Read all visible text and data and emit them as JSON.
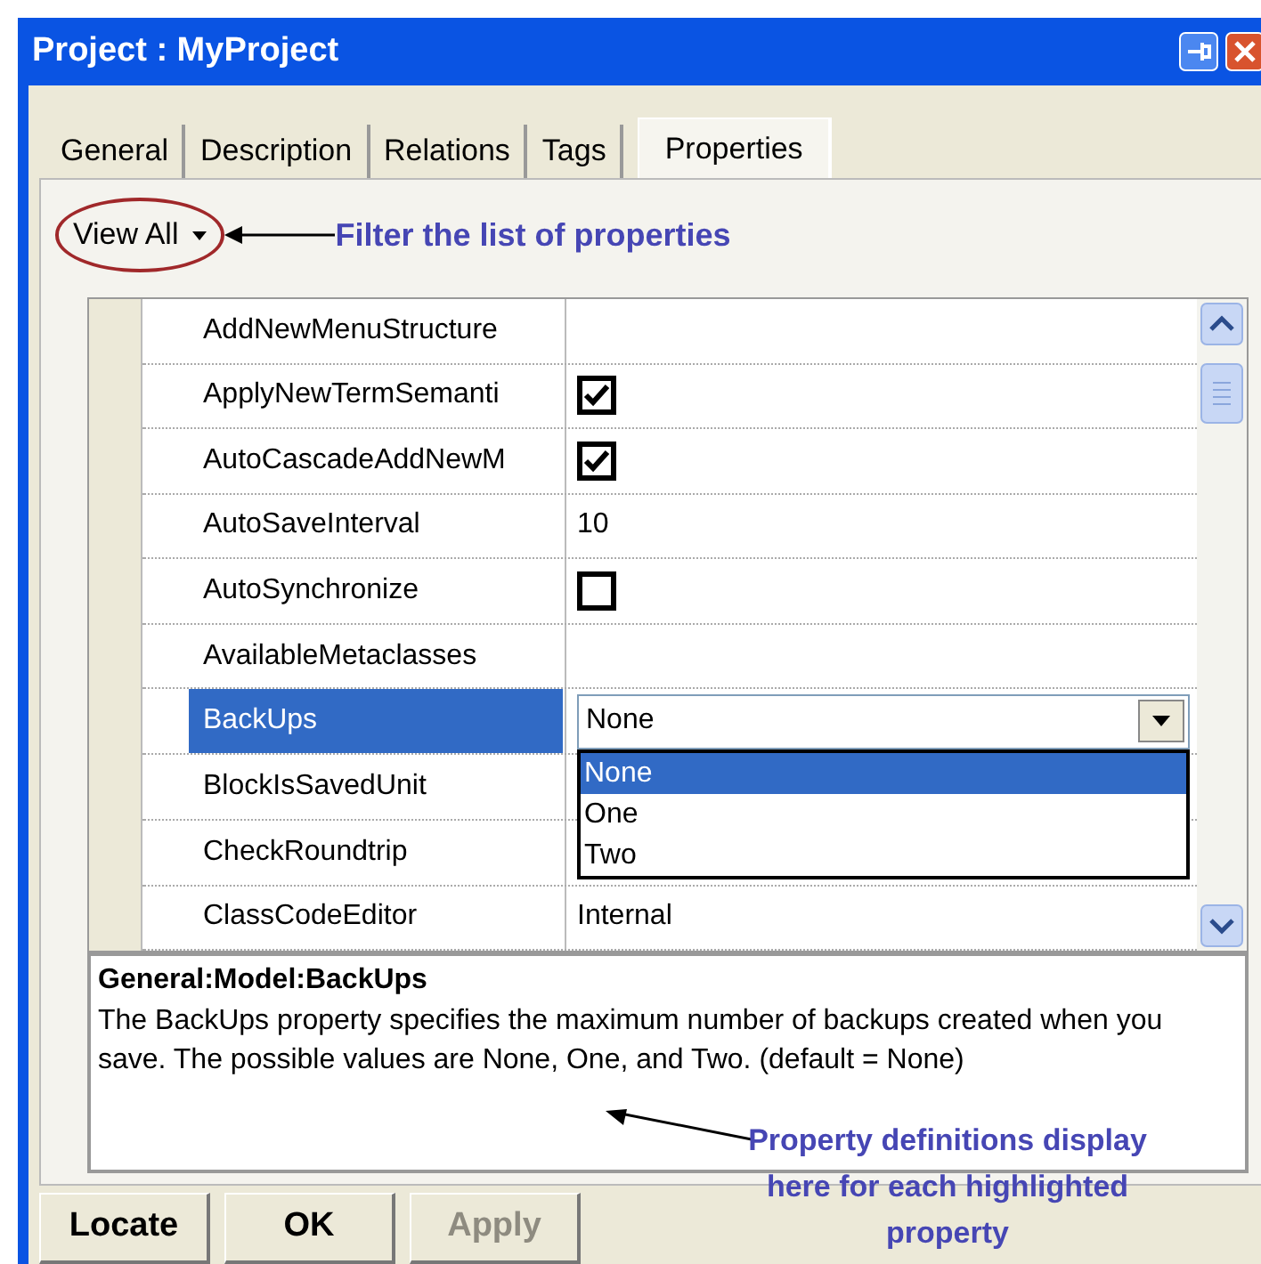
{
  "window": {
    "title": "Project : MyProject"
  },
  "tabs": [
    {
      "label": "General",
      "selected": false
    },
    {
      "label": "Description",
      "selected": false
    },
    {
      "label": "Relations",
      "selected": false
    },
    {
      "label": "Tags",
      "selected": false
    },
    {
      "label": "Properties",
      "selected": true
    }
  ],
  "filter": {
    "value": "View All"
  },
  "filter_note": "Filter the list of properties",
  "properties": [
    {
      "name": "AddNewMenuStructure",
      "selected": false,
      "kind": "empty"
    },
    {
      "name": "ApplyNewTermSemanti",
      "selected": false,
      "kind": "checkbox",
      "checked": true
    },
    {
      "name": "AutoCascadeAddNewM",
      "selected": false,
      "kind": "checkbox",
      "checked": true
    },
    {
      "name": "AutoSaveInterval",
      "selected": false,
      "kind": "text",
      "value": "10"
    },
    {
      "name": "AutoSynchronize",
      "selected": false,
      "kind": "checkbox",
      "checked": false
    },
    {
      "name": "AvailableMetaclasses",
      "selected": false,
      "kind": "empty"
    },
    {
      "name": "BackUps",
      "selected": true,
      "kind": "dropdown",
      "value": "None",
      "expanded": true,
      "options": [
        {
          "label": "None",
          "selected": true
        },
        {
          "label": "One",
          "selected": false
        },
        {
          "label": "Two",
          "selected": false
        }
      ]
    },
    {
      "name": "BlockIsSavedUnit",
      "selected": false,
      "kind": "empty"
    },
    {
      "name": "CheckRoundtrip",
      "selected": false,
      "kind": "empty"
    },
    {
      "name": "ClassCodeEditor",
      "selected": false,
      "kind": "text",
      "value": "Internal"
    }
  ],
  "description": {
    "title": "General:Model:BackUps",
    "text": "The  BackUps property specifies the maximum number of backups created when you save. The possible values are  None,  One, and  Two. (default = None)"
  },
  "description_note": "Property definitions display here for each highlighted property",
  "buttons": [
    {
      "label": "Locate",
      "disabled": false
    },
    {
      "label": "OK",
      "disabled": false
    },
    {
      "label": "Apply",
      "disabled": true
    }
  ]
}
